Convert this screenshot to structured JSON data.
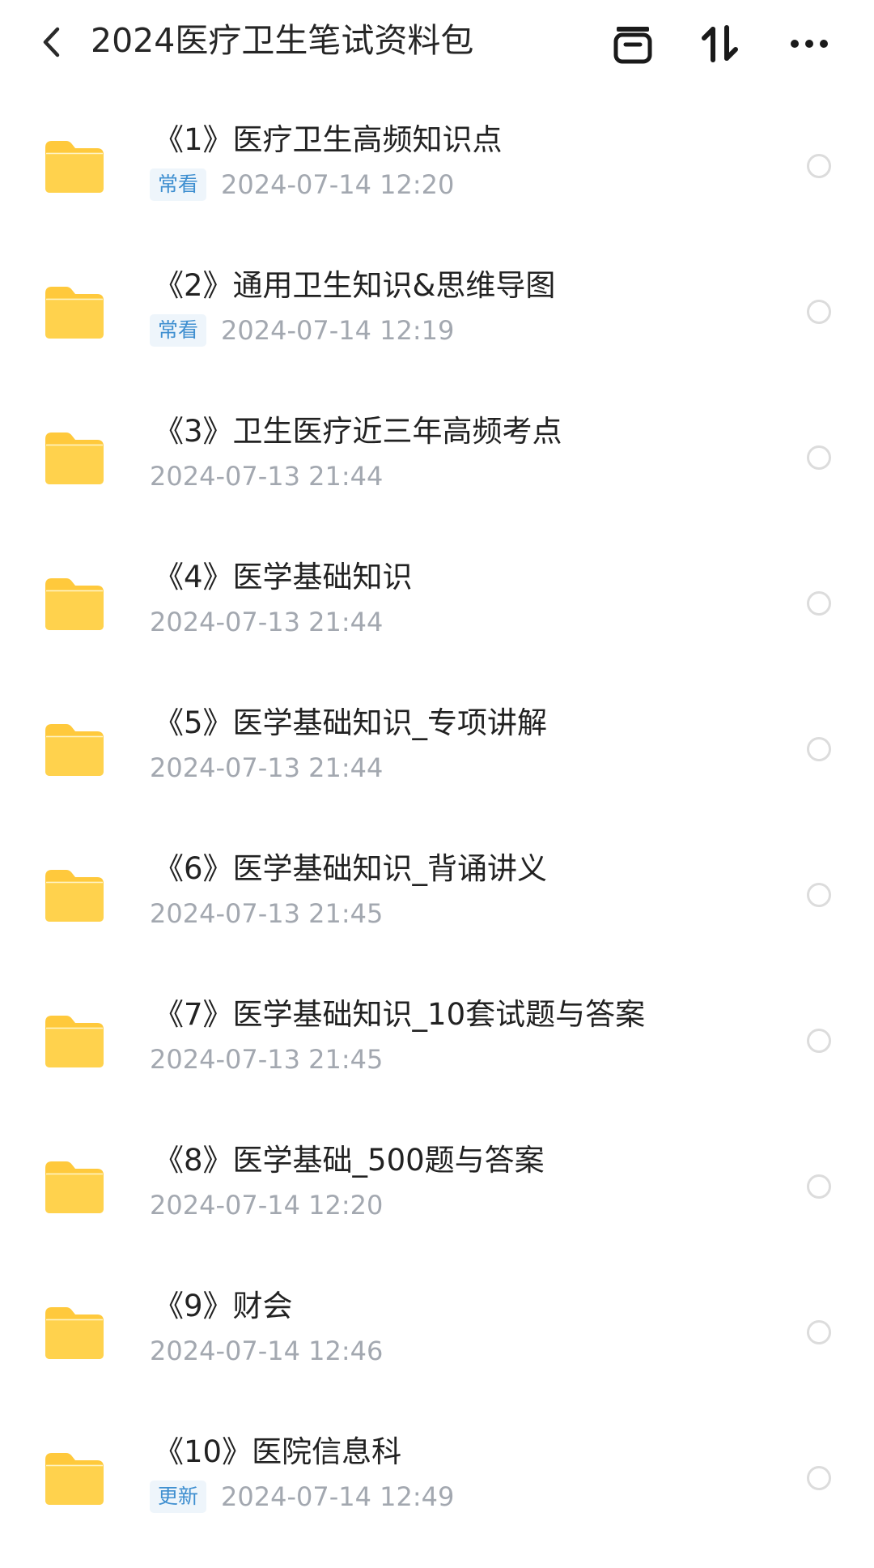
{
  "header": {
    "title": "2024医疗卫生笔试资料包",
    "icons": [
      "back-arrow",
      "archive-box",
      "sort-arrows",
      "more-dots"
    ]
  },
  "colors": {
    "folder": "#ffc93c",
    "tag_bg": "#eef5fb",
    "tag_text": "#3f8fd0",
    "date_text": "#a3a8b0"
  },
  "folders": [
    {
      "name": "《1》医疗卫生高频知识点",
      "tag": "常看",
      "date": "2024-07-14  12:20"
    },
    {
      "name": "《2》通用卫生知识&思维导图",
      "tag": "常看",
      "date": "2024-07-14  12:19"
    },
    {
      "name": "《3》卫生医疗近三年高频考点",
      "tag": "",
      "date": "2024-07-13  21:44"
    },
    {
      "name": "《4》医学基础知识",
      "tag": "",
      "date": "2024-07-13  21:44"
    },
    {
      "name": "《5》医学基础知识_专项讲解",
      "tag": "",
      "date": "2024-07-13  21:44"
    },
    {
      "name": "《6》医学基础知识_背诵讲义",
      "tag": "",
      "date": "2024-07-13  21:45"
    },
    {
      "name": "《7》医学基础知识_10套试题与答案",
      "tag": "",
      "date": "2024-07-13  21:45"
    },
    {
      "name": "《8》医学基础_500题与答案",
      "tag": "",
      "date": "2024-07-14  12:20"
    },
    {
      "name": "《9》财会",
      "tag": "",
      "date": "2024-07-14  12:46"
    },
    {
      "name": "《10》医院信息科",
      "tag": "更新",
      "date": "2024-07-14  12:49"
    }
  ]
}
